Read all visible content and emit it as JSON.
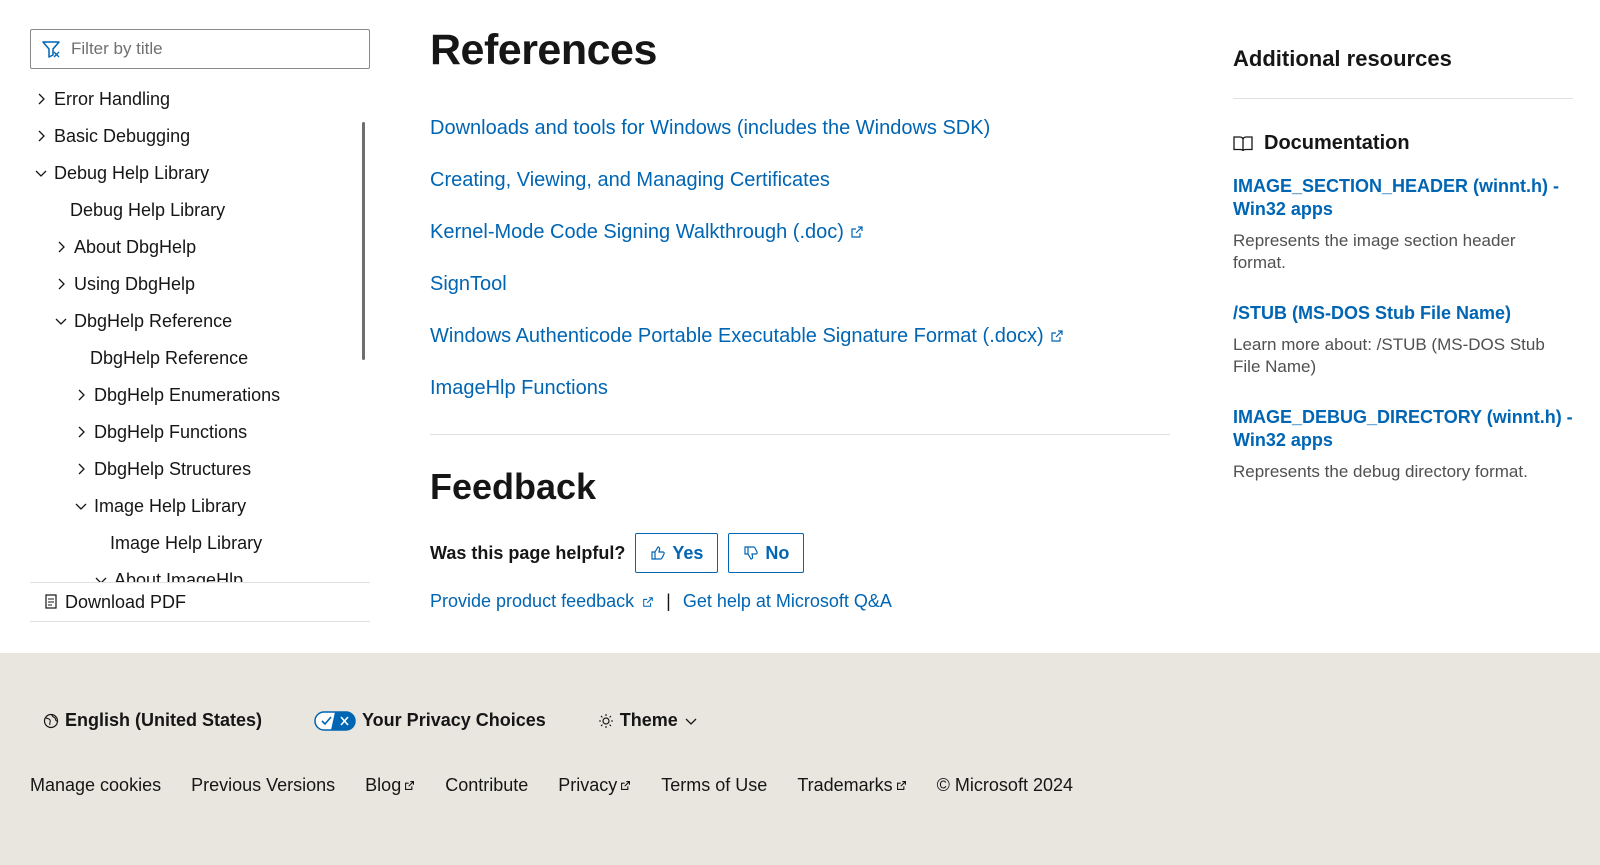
{
  "sidebar": {
    "filter_placeholder": "Filter by title",
    "toc": [
      {
        "label": "Error Handling",
        "chevron": "right"
      },
      {
        "label": "Basic Debugging",
        "chevron": "right"
      },
      {
        "label": "Debug Help Library",
        "chevron": "down"
      },
      {
        "label": "Debug Help Library",
        "chevron": "none"
      },
      {
        "label": "About DbgHelp",
        "chevron": "right"
      },
      {
        "label": "Using DbgHelp",
        "chevron": "right"
      },
      {
        "label": "DbgHelp Reference",
        "chevron": "down"
      },
      {
        "label": "DbgHelp Reference",
        "chevron": "none"
      },
      {
        "label": "DbgHelp Enumerations",
        "chevron": "right"
      },
      {
        "label": "DbgHelp Functions",
        "chevron": "right"
      },
      {
        "label": "DbgHelp Structures",
        "chevron": "right"
      },
      {
        "label": "Image Help Library",
        "chevron": "down"
      },
      {
        "label": "Image Help Library",
        "chevron": "none"
      },
      {
        "label": "About ImageHlp",
        "chevron": "down"
      }
    ],
    "download_pdf": "Download PDF"
  },
  "main": {
    "title": "References",
    "references": [
      {
        "label": "Downloads and tools for Windows (includes the Windows SDK)",
        "external": false
      },
      {
        "label": "Creating, Viewing, and Managing Certificates",
        "external": false
      },
      {
        "label": "Kernel-Mode Code Signing Walkthrough (.doc)",
        "external": true
      },
      {
        "label": "SignTool",
        "external": false
      },
      {
        "label": "Windows Authenticode Portable Executable Signature Format (.docx)",
        "external": true
      },
      {
        "label": "ImageHlp Functions",
        "external": false
      }
    ],
    "feedback_title": "Feedback",
    "helpful_question": "Was this page helpful?",
    "yes_label": "Yes",
    "no_label": "No",
    "product_feedback": "Provide product feedback",
    "separator": "|",
    "get_help": "Get help at Microsoft Q&A"
  },
  "rail": {
    "title": "Additional resources",
    "documentation_label": "Documentation",
    "resources": [
      {
        "title": "IMAGE_SECTION_HEADER (winnt.h) - Win32 apps",
        "description": "Represents the image section header format."
      },
      {
        "title": "/STUB (MS-DOS Stub File Name)",
        "description": "Learn more about: /STUB (MS-DOS Stub File Name)"
      },
      {
        "title": "IMAGE_DEBUG_DIRECTORY (winnt.h) - Win32 apps",
        "description": "Represents the debug directory format."
      }
    ]
  },
  "footer": {
    "language": "English (United States)",
    "privacy_choices": "Your Privacy Choices",
    "theme": "Theme",
    "links": [
      {
        "label": "Manage cookies",
        "external": false
      },
      {
        "label": "Previous Versions",
        "external": false
      },
      {
        "label": "Blog",
        "external": true
      },
      {
        "label": "Contribute",
        "external": false
      },
      {
        "label": "Privacy",
        "external": true
      },
      {
        "label": "Terms of Use",
        "external": false
      },
      {
        "label": "Trademarks",
        "external": true
      }
    ],
    "copyright": "© Microsoft 2024"
  },
  "colors": {
    "link": "#0065b3",
    "footer_bg": "#e9e6e0",
    "privacy_toggle": "#0065b3"
  }
}
